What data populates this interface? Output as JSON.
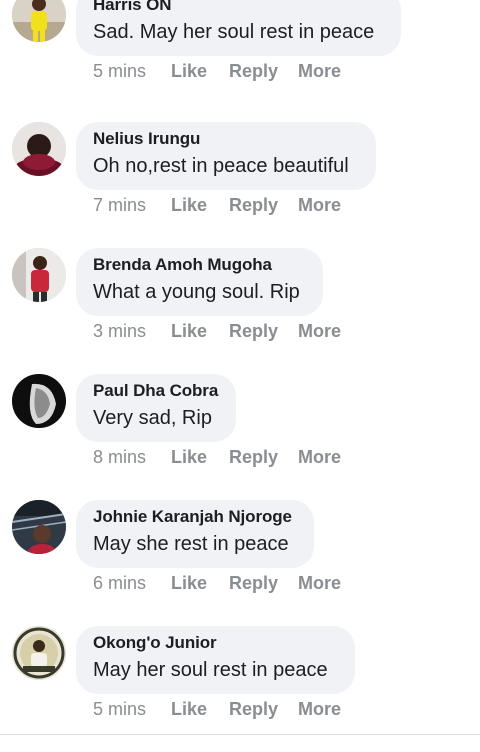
{
  "comments": [
    {
      "author": "Harris ON",
      "text": "Sad. May her soul rest in peace",
      "time": "5 mins",
      "like": "Like",
      "reply": "Reply",
      "more": "More",
      "avatar": "avatar-yellow"
    },
    {
      "author": "Nelius Irungu",
      "text": "Oh no,rest in peace beautiful",
      "time": "7 mins",
      "like": "Like",
      "reply": "Reply",
      "more": "More",
      "avatar": "avatar-dark"
    },
    {
      "author": "Brenda Amoh Mugoha",
      "text": "What a young soul. Rip",
      "time": "3 mins",
      "like": "Like",
      "reply": "Reply",
      "more": "More",
      "avatar": "avatar-red"
    },
    {
      "author": "Paul Dha Cobra",
      "text": "Very sad, Rip",
      "time": "8 mins",
      "like": "Like",
      "reply": "Reply",
      "more": "More",
      "avatar": "avatar-bw"
    },
    {
      "author": "Johnie Karanjah Njoroge",
      "text": "May she rest in peace",
      "time": "6 mins",
      "like": "Like",
      "reply": "Reply",
      "more": "More",
      "avatar": "avatar-indoor"
    },
    {
      "author": "Okong'o Junior",
      "text": "May her soul rest in peace",
      "time": "5 mins",
      "like": "Like",
      "reply": "Reply",
      "more": "More",
      "avatar": "avatar-badge"
    }
  ],
  "colors": {
    "bubble": "#f0f2f5",
    "name": "#1c1e21",
    "meta": "#8a8d91"
  }
}
